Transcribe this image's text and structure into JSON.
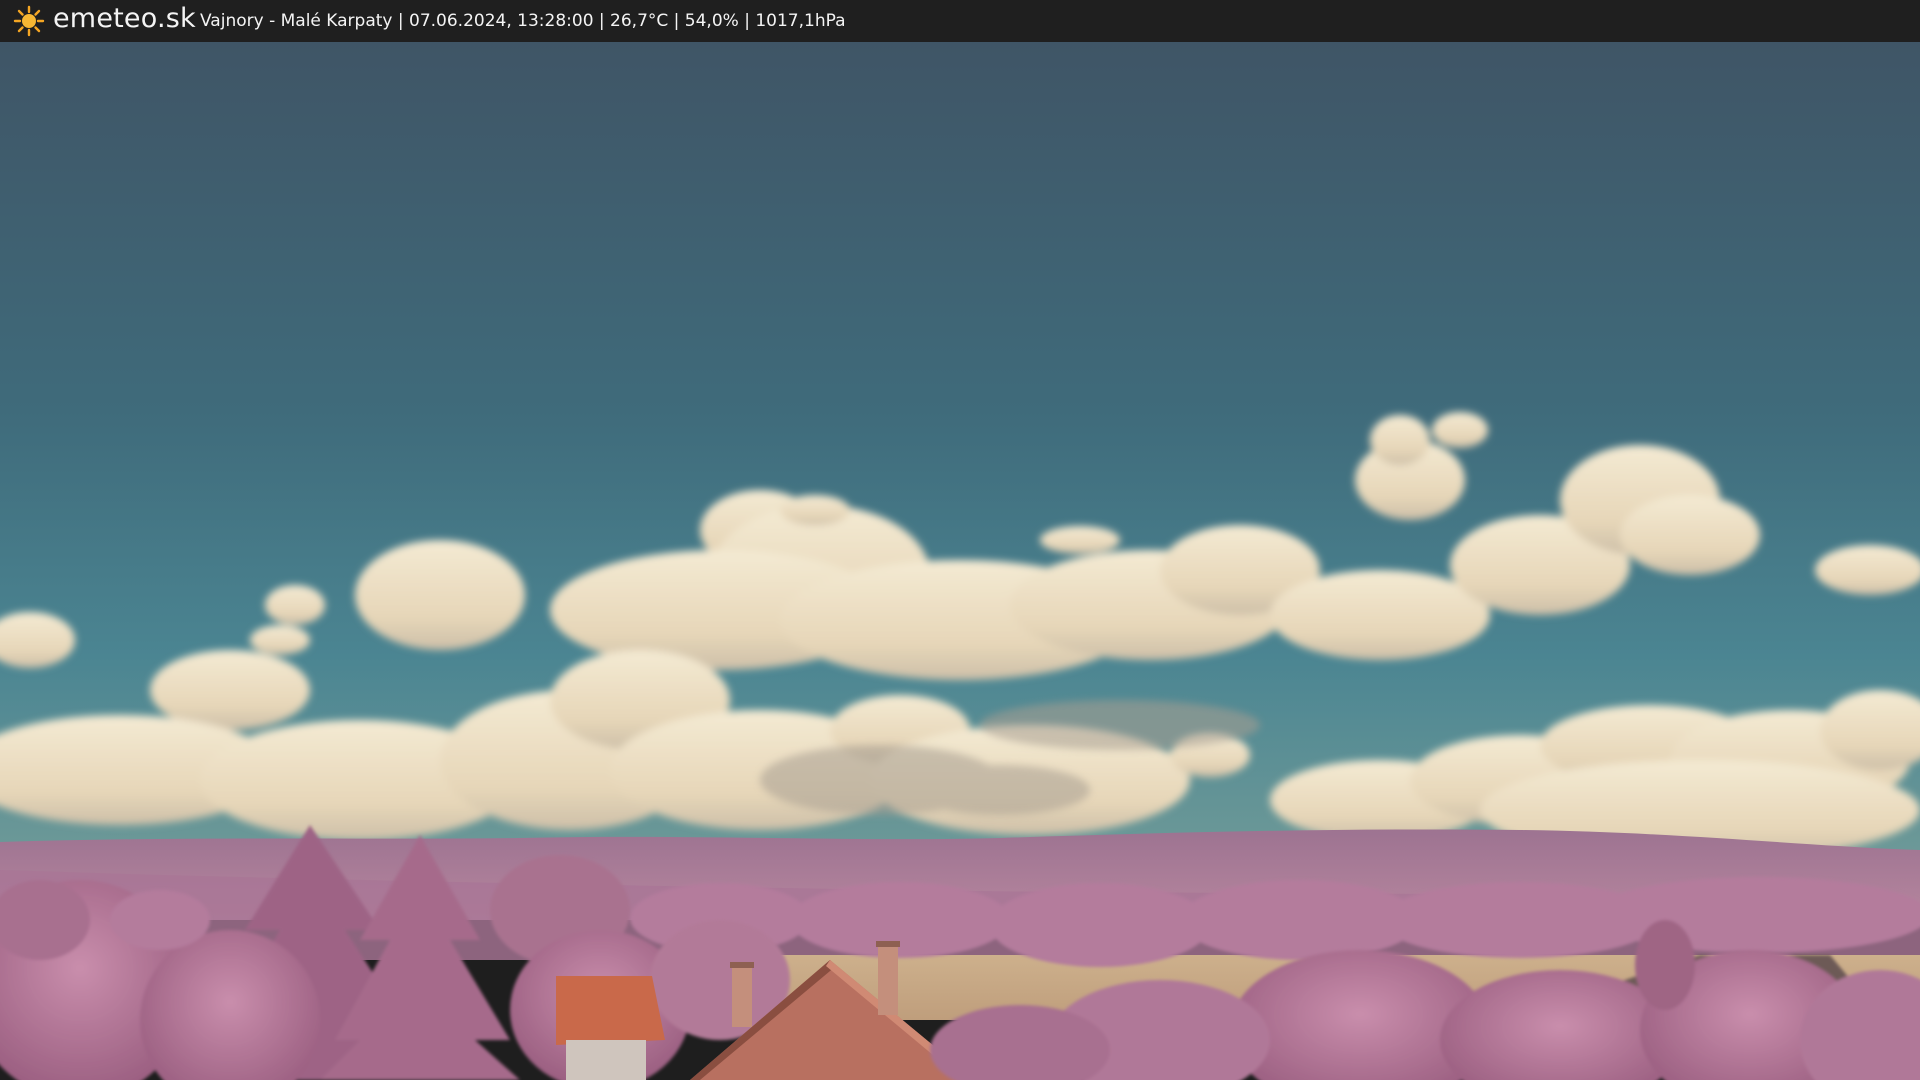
{
  "header": {
    "brand": "emeteo.sk",
    "icon": "sun-icon",
    "caption": "Vajnory - Malé Karpaty | 07.06.2024, 13:28:00 | 26,7°C | 54,0% | 1017,1hPa"
  },
  "colors": {
    "bar_background": "#1f1f1f",
    "sky_top": "#3f5566",
    "sky_bottom": "#4c8491",
    "cloud": "#efe2c6",
    "hills": "#a87a9c",
    "trees": "#b8789a",
    "field": "#c9aa86",
    "roof": "#c96a4c"
  }
}
